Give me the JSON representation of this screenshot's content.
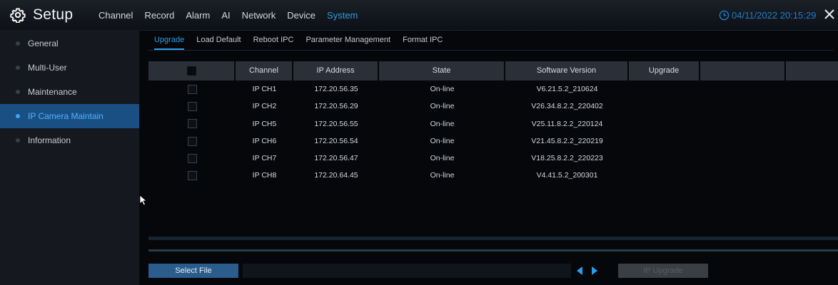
{
  "header": {
    "title": "Setup",
    "menu": [
      "Channel",
      "Record",
      "Alarm",
      "AI",
      "Network",
      "Device",
      "System"
    ],
    "active_menu": "System",
    "datetime": "04/11/2022 20:15:29"
  },
  "sidebar": {
    "items": [
      {
        "label": "General"
      },
      {
        "label": "Multi-User"
      },
      {
        "label": "Maintenance"
      },
      {
        "label": "IP Camera Maintain"
      },
      {
        "label": "Information"
      }
    ],
    "active": "IP Camera Maintain"
  },
  "subtabs": [
    "Upgrade",
    "Load Default",
    "Reboot IPC",
    "Parameter Management",
    "Format IPC"
  ],
  "active_subtab": "Upgrade",
  "table": {
    "columns": [
      "",
      "Channel",
      "IP Address",
      "State",
      "Software Version",
      "Upgrade",
      "",
      ""
    ],
    "rows": [
      {
        "channel": "IP CH1",
        "ip": "172.20.56.35",
        "state": "On-line",
        "version": "V6.21.5.2_210624"
      },
      {
        "channel": "IP CH2",
        "ip": "172.20.56.29",
        "state": "On-line",
        "version": "V26.34.8.2.2_220402"
      },
      {
        "channel": "IP CH5",
        "ip": "172.20.56.55",
        "state": "On-line",
        "version": "V25.11.8.2.2_220124"
      },
      {
        "channel": "IP CH6",
        "ip": "172.20.56.54",
        "state": "On-line",
        "version": "V21.45.8.2.2_220219"
      },
      {
        "channel": "IP CH7",
        "ip": "172.20.56.47",
        "state": "On-line",
        "version": "V18.25.8.2.2_220223"
      },
      {
        "channel": "IP CH8",
        "ip": "172.20.64.45",
        "state": "On-line",
        "version": "V4.41.5.2_200301"
      }
    ]
  },
  "footer": {
    "select_file_label": "Select File",
    "upgrade_label": "IP Upgrade"
  },
  "colors": {
    "accent": "#2a9ee8",
    "sidebar_active": "#1a4f84",
    "button": "#2a5d8c"
  },
  "icons": {
    "settings": "gear-icon",
    "clock": "clock-icon",
    "close": "close-icon",
    "prev": "arrow-left-icon",
    "next": "arrow-right-icon"
  }
}
